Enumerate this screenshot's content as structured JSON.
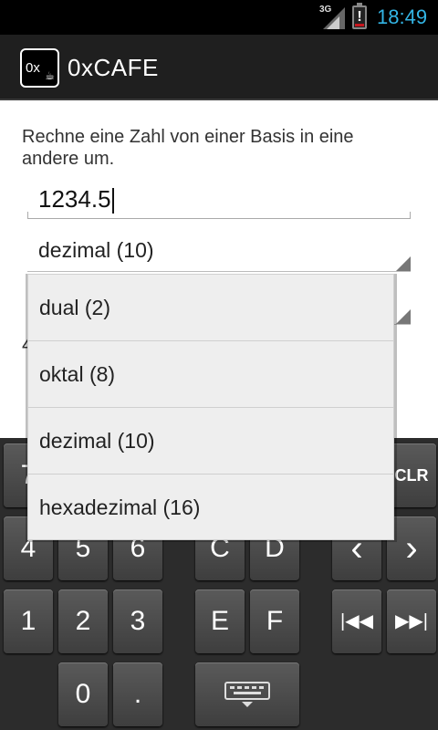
{
  "status_bar": {
    "network": "3G",
    "time": "18:49",
    "battery_alert": "!",
    "battery_level": 0.15,
    "clock_color": "#33b5e5"
  },
  "app": {
    "icon_text": "0x",
    "title": "0xCAFE"
  },
  "main": {
    "instruction": "Rechne eine Zahl von einer Basis in eine andere um.",
    "input_value": "1234.5",
    "from_base": "dezimal (10)",
    "result_peek": "4"
  },
  "dropdown": {
    "items": [
      "dual (2)",
      "oktal (8)",
      "dezimal (10)",
      "hexadezimal (16)"
    ]
  },
  "keypad": {
    "row1": {
      "k1": "7",
      "k_clr": "CLR"
    },
    "row2": {
      "k1": "4",
      "k2": "5",
      "k3": "6",
      "k4": "C",
      "k5": "D",
      "left": "‹",
      "right": "›"
    },
    "row3": {
      "k1": "1",
      "k2": "2",
      "k3": "3",
      "k4": "E",
      "k5": "F",
      "first": "|◀◀",
      "last": "▶▶|"
    },
    "row4": {
      "k0": "0",
      "dot": "."
    }
  }
}
